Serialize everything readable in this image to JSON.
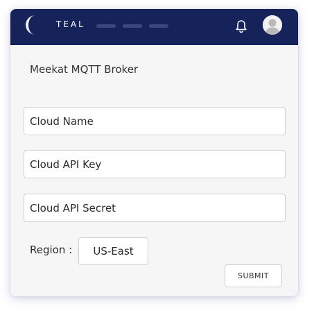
{
  "header": {
    "brand": "TEAL",
    "logo_icon": "crescent-moon-icon",
    "notification_icon": "bell-icon",
    "avatar_icon": "user-avatar-icon",
    "background_color": "#16235b"
  },
  "page": {
    "title": "Meekat MQTT Broker"
  },
  "form": {
    "cloud_name_placeholder": "Cloud Name",
    "cloud_api_key_placeholder": "Cloud API Key",
    "cloud_api_secret_placeholder": "Cloud API Secret",
    "region_label": "Region :",
    "region_value": "US-East",
    "submit_label": "SUBMIT"
  }
}
